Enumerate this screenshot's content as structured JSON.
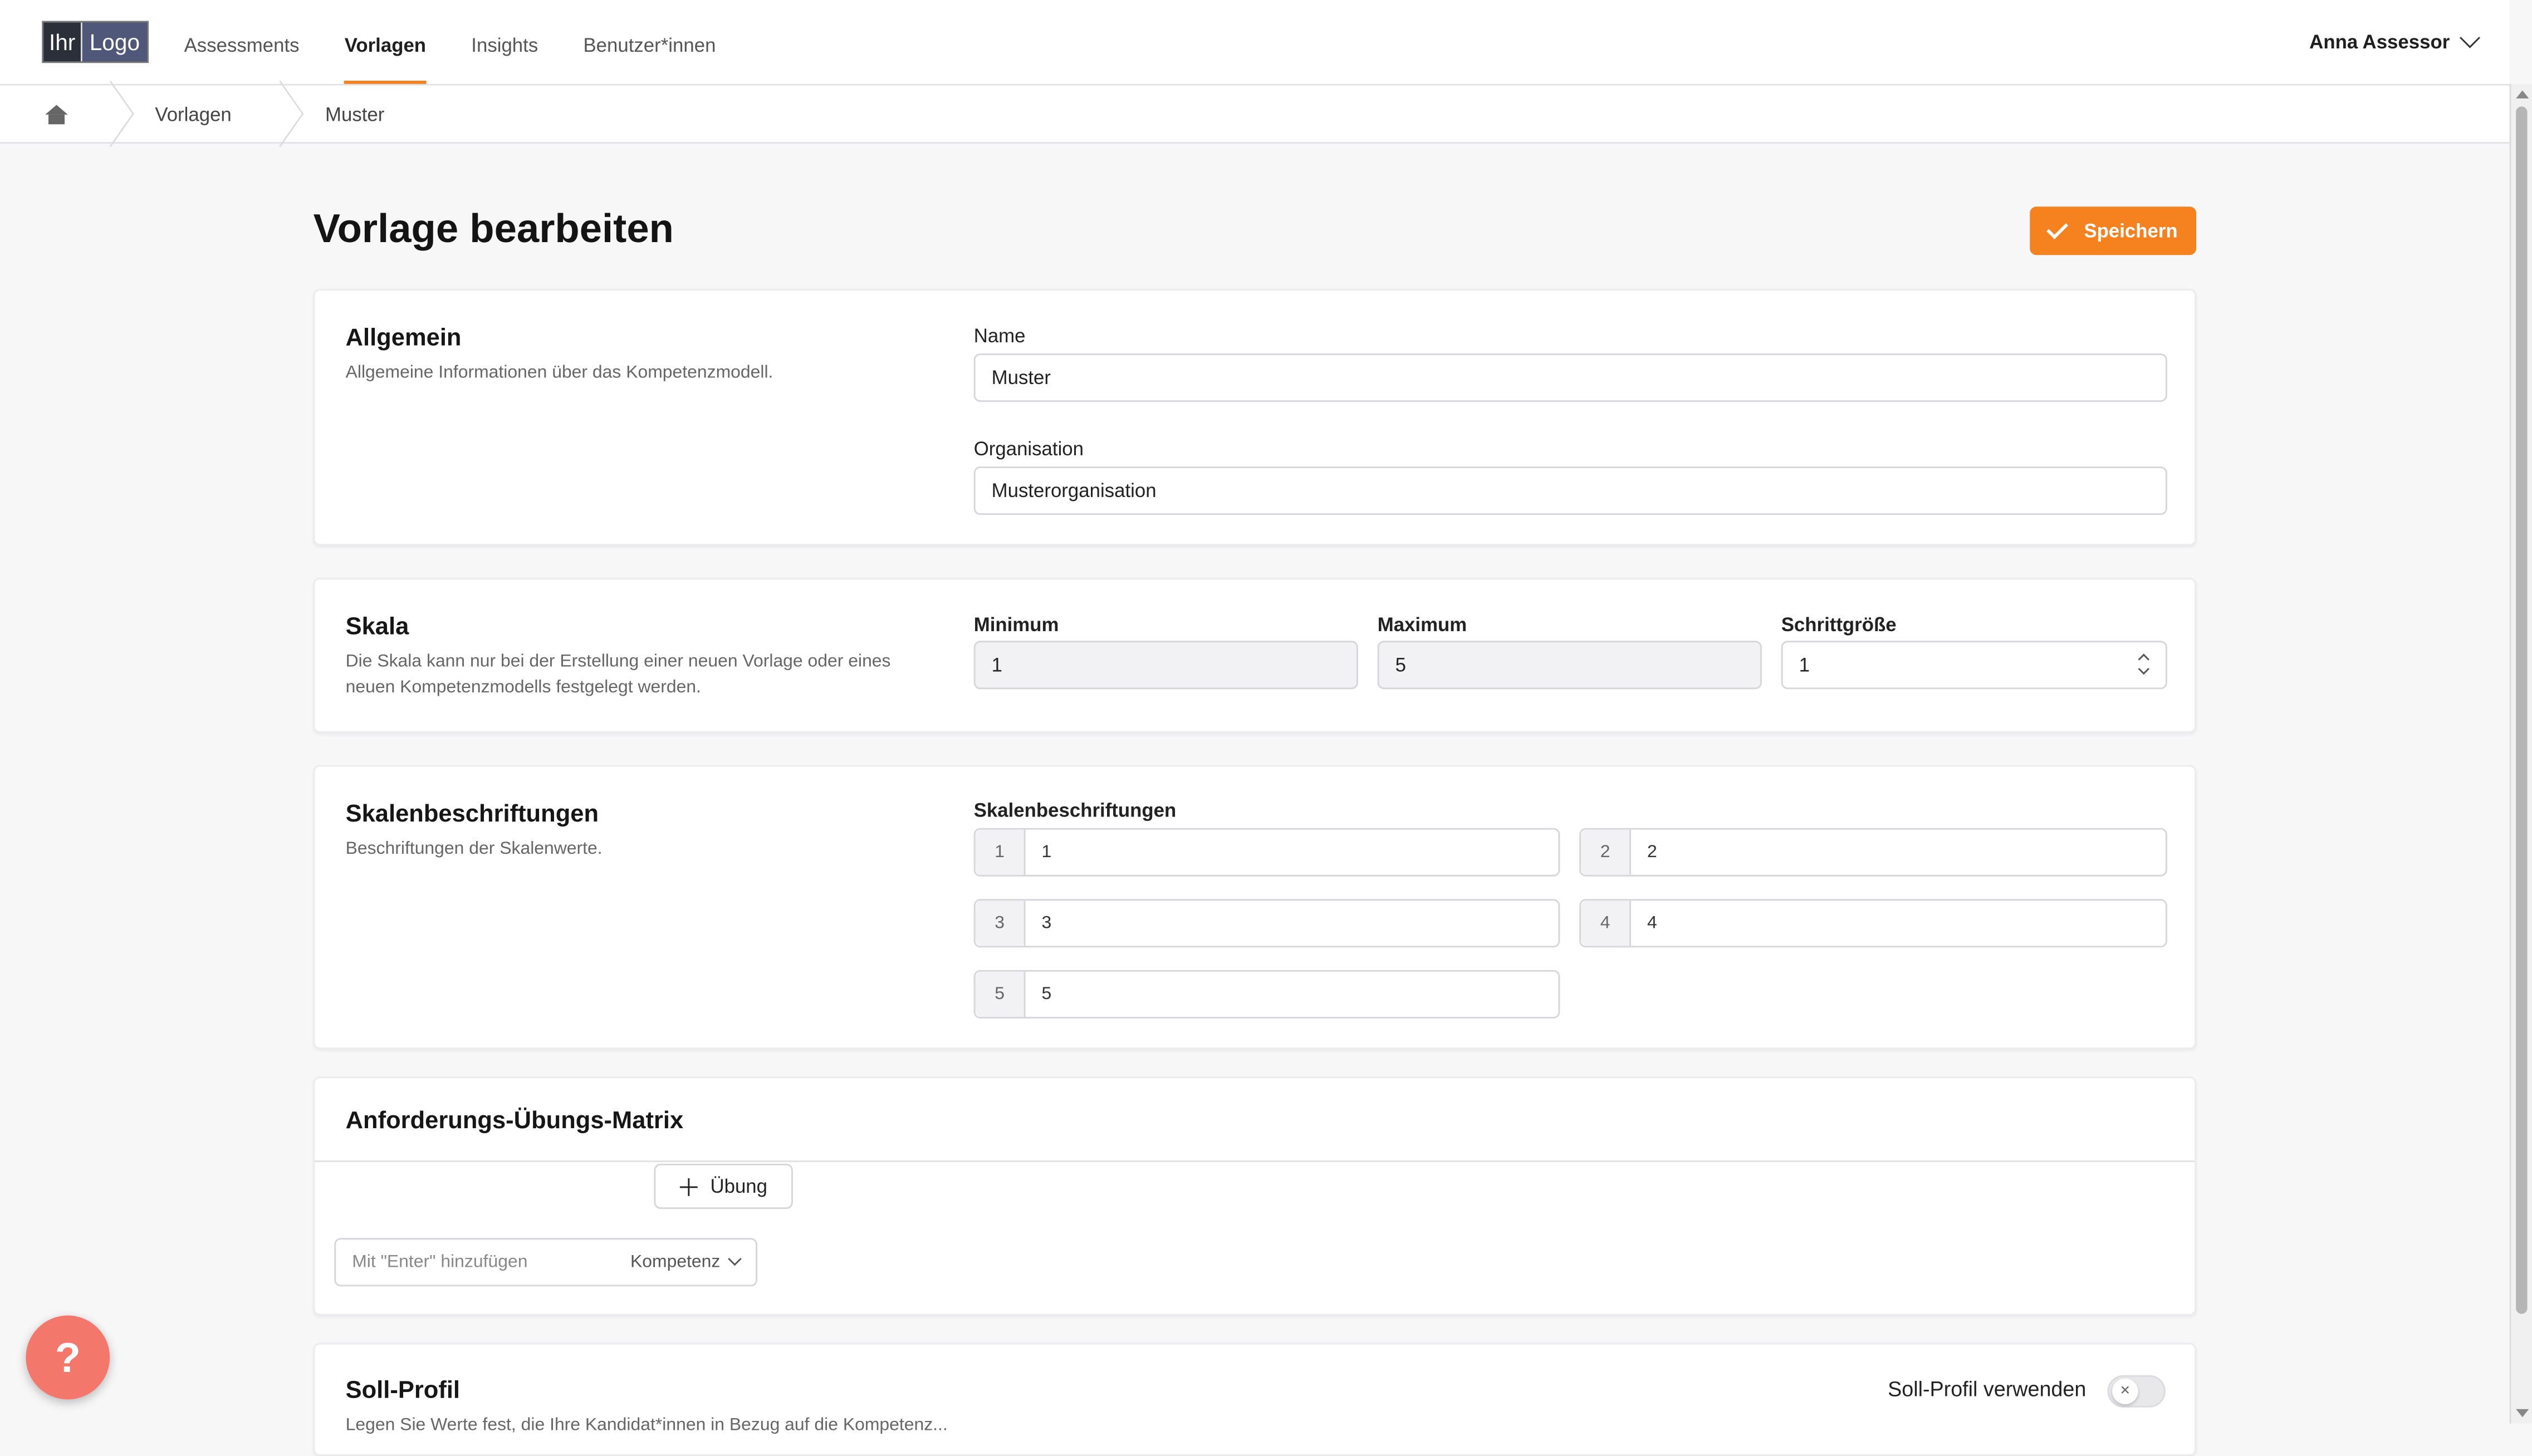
{
  "logo": {
    "part1": "Ihr",
    "part2": "Logo"
  },
  "nav": {
    "items": [
      {
        "label": "Assessments",
        "active": false
      },
      {
        "label": "Vorlagen",
        "active": true
      },
      {
        "label": "Insights",
        "active": false
      },
      {
        "label": "Benutzer*innen",
        "active": false
      }
    ],
    "user": "Anna Assessor"
  },
  "breadcrumb": {
    "items": [
      "Vorlagen",
      "Muster"
    ]
  },
  "page": {
    "title": "Vorlage bearbeiten",
    "save_label": "Speichern",
    "accent_color": "#f5821f"
  },
  "general": {
    "title": "Allgemein",
    "description": "Allgemeine Informationen über das Kompetenzmodell.",
    "name_label": "Name",
    "name_value": "Muster",
    "org_label": "Organisation",
    "org_value": "Musterorganisation"
  },
  "scale": {
    "title": "Skala",
    "description": "Die Skala kann nur bei der Erstellung einer neuen Vorlage oder eines neuen Kompetenzmodells festgelegt werden.",
    "min_label": "Minimum",
    "min_value": "1",
    "max_label": "Maximum",
    "max_value": "5",
    "step_label": "Schrittgröße",
    "step_value": "1"
  },
  "scale_labels": {
    "title": "Skalenbeschriftungen",
    "description": "Beschriftungen der Skalenwerte.",
    "field_label": "Skalenbeschriftungen",
    "items": [
      {
        "index": "1",
        "value": "1"
      },
      {
        "index": "2",
        "value": "2"
      },
      {
        "index": "3",
        "value": "3"
      },
      {
        "index": "4",
        "value": "4"
      },
      {
        "index": "5",
        "value": "5"
      }
    ]
  },
  "matrix": {
    "title": "Anforderungs-Übungs-Matrix",
    "add_exercise_label": "Übung",
    "competency_placeholder": "Mit \"Enter\" hinzufügen",
    "competency_dropdown": "Kompetenz"
  },
  "target_profile": {
    "title": "Soll-Profil",
    "toggle_label": "Soll-Profil verwenden",
    "toggle_on": false,
    "description_partial": "Legen Sie Werte fest, die Ihre Kandidat*innen in Bezug auf die Kompetenz..."
  },
  "help": {
    "label": "?",
    "color": "#f4776b"
  }
}
